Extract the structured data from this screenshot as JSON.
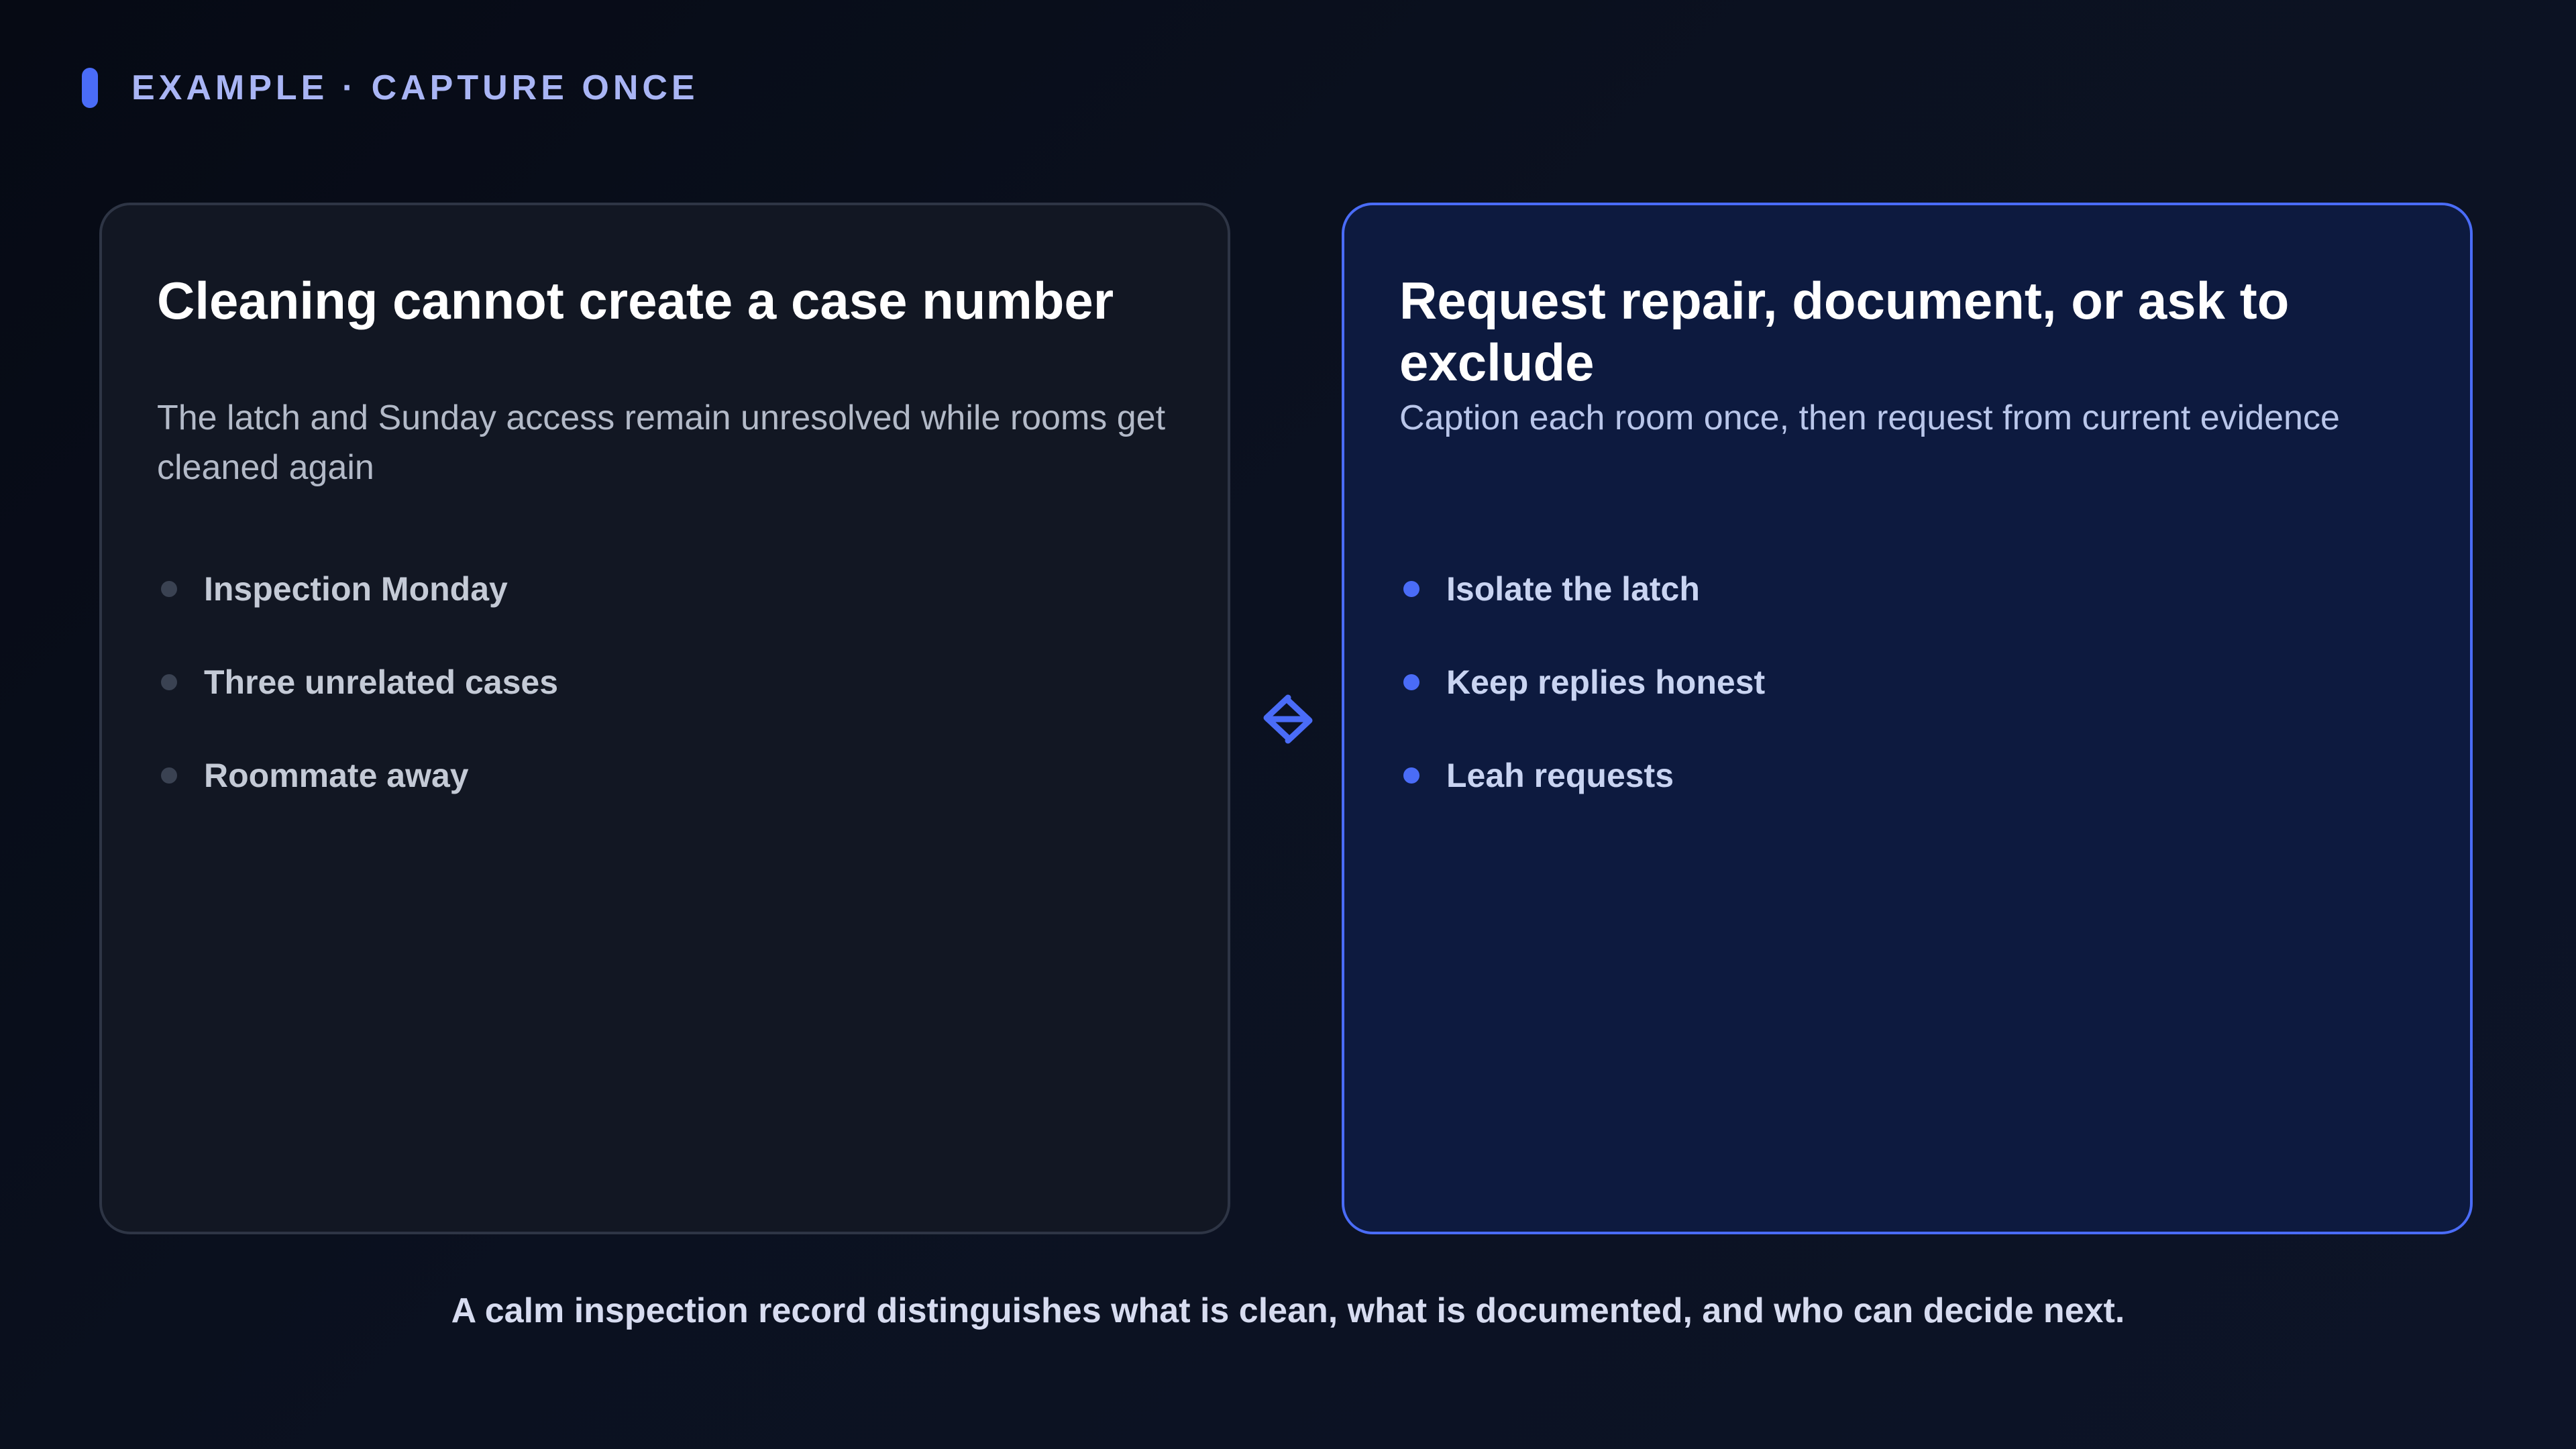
{
  "header": {
    "eyebrow": "EXAMPLE · CAPTURE ONCE"
  },
  "left_card": {
    "title": "Cleaning cannot create a case number",
    "description": "The latch and Sunday access remain unresolved while rooms get cleaned again",
    "items": [
      "Inspection Monday",
      "Three unrelated cases",
      "Roommate away"
    ]
  },
  "right_card": {
    "title": "Request repair, document, or ask to exclude",
    "description": "Caption each room once, then request from current evidence",
    "items": [
      "Isolate the latch",
      "Keep replies honest",
      "Leah requests"
    ]
  },
  "divider_icon": "swap-arrows-icon",
  "footer": {
    "text": "A calm inspection record distinguishes what is clean, what is documented, and who can decide next."
  },
  "colors": {
    "accent": "#4a6cf7",
    "background": "#0b1120",
    "left_card_bg": "#121723",
    "right_card_bg": "#0d1a3f",
    "eyebrow_text": "#a9b5f5"
  }
}
